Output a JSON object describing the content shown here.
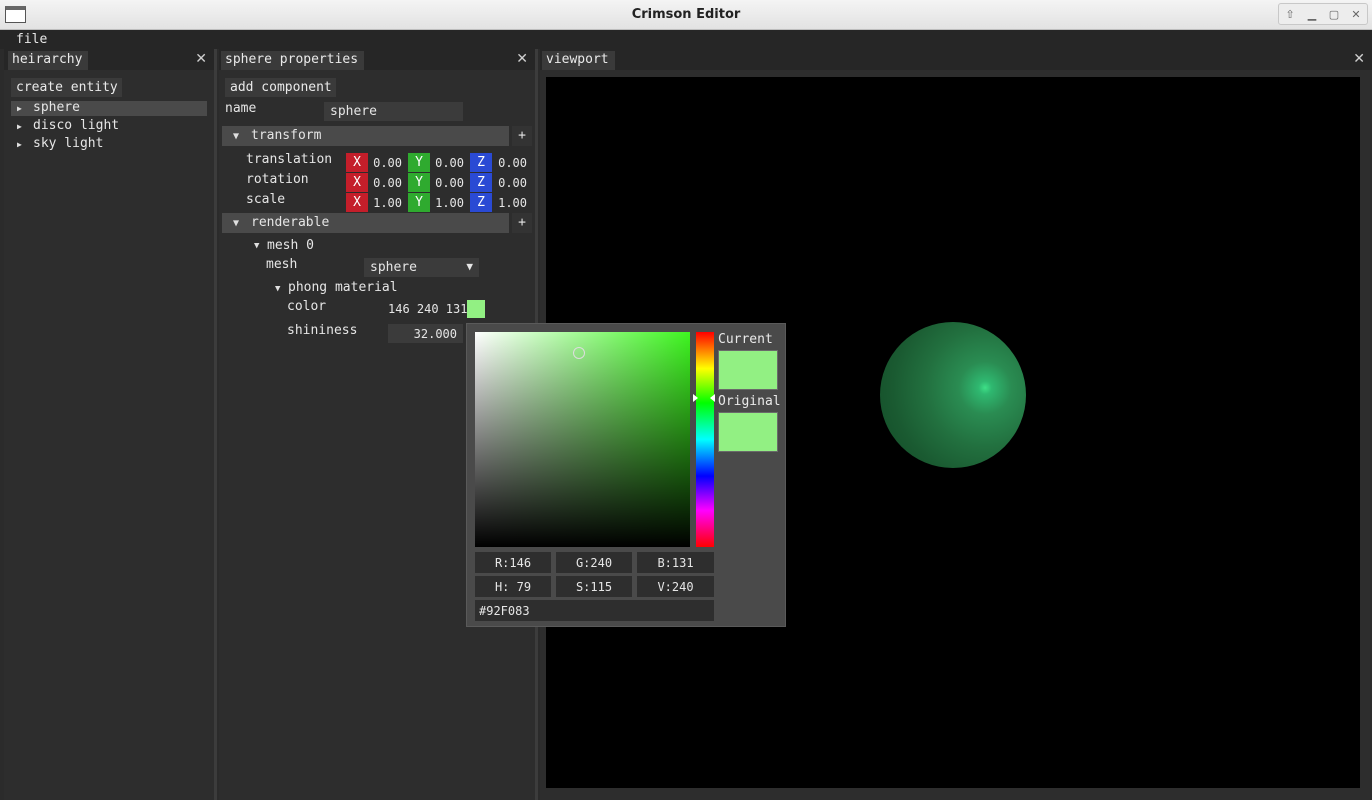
{
  "window": {
    "title": "Crimson Editor"
  },
  "menubar": {
    "file": "file"
  },
  "hierarchy": {
    "tab": "heirarchy",
    "create_entity": "create entity",
    "items": [
      "sphere",
      "disco light",
      "sky light"
    ]
  },
  "properties": {
    "tab": "sphere properties",
    "add_component": "add component",
    "name_label": "name",
    "name_value": "sphere",
    "transform": {
      "title": "transform",
      "plus": "+",
      "rows": [
        {
          "label": "translation",
          "x": "0.00",
          "y": "0.00",
          "z": "0.00"
        },
        {
          "label": "rotation",
          "x": "0.00",
          "y": "0.00",
          "z": "0.00"
        },
        {
          "label": "scale",
          "x": "1.00",
          "y": "1.00",
          "z": "1.00"
        }
      ],
      "axis_x": "X",
      "axis_y": "Y",
      "axis_z": "Z"
    },
    "renderable": {
      "title": "renderable",
      "plus": "+",
      "mesh_node": "mesh 0",
      "mesh_label": "mesh",
      "mesh_value": "sphere",
      "material": "phong material",
      "color_label": "color",
      "color_value": "146 240 131",
      "shininess_label": "shininess",
      "shininess_value": "32.000"
    }
  },
  "viewport": {
    "tab": "viewport"
  },
  "color_picker": {
    "current_label": "Current",
    "original_label": "Original",
    "r": "R:146",
    "g": "G:240",
    "b": "B:131",
    "h": "H: 79",
    "s": "S:115",
    "v": "V:240",
    "hex": "#92F083",
    "color": "#92F083"
  }
}
